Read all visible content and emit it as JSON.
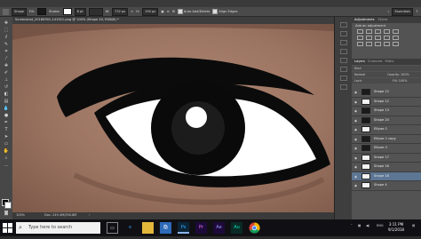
{
  "options_bar": {
    "mode": "Shape",
    "fill_label": "Fill:",
    "stroke_label": "Stroke:",
    "stroke_width": "8 pt",
    "w_label": "W:",
    "w_value": "732 px",
    "h_label": "H:",
    "h_value": "190 px",
    "auto_add_delete": "Auto Add/Delete",
    "align_edges": "Align Edges",
    "workspace": "Essentials",
    "accent_fill": "#1a1a1a"
  },
  "document": {
    "tab_title": "Screenshot_20180901-141921.png @ 100% (Shape 20, RGB/8) *",
    "zoom": "100%",
    "doc_size": "Doc: 249.4M/390.8M"
  },
  "panels": {
    "tab_adjustments": "Adjustments",
    "tab_styles": "Styles",
    "adjustments_title": "Add an adjustment",
    "tab_layers": "Layers",
    "tab_channels": "Channels",
    "tab_paths": "Paths",
    "kind_label": "Kind",
    "blend_mode": "Normal",
    "opacity_label": "Opacity: 100%",
    "lock_label": "Lock:",
    "fill_label": "Fill: 100%",
    "layers": [
      {
        "name": "Shape 12",
        "thumb": "dark"
      },
      {
        "name": "Shape 12",
        "thumb": "light"
      },
      {
        "name": "Shape 13",
        "thumb": "dark"
      },
      {
        "name": "Shape 20",
        "thumb": "dark"
      },
      {
        "name": "Ellipse 1",
        "thumb": "light"
      },
      {
        "name": "Ellipse 1 copy",
        "thumb": "dark"
      },
      {
        "name": "Ellipse 2",
        "thumb": "dark"
      },
      {
        "name": "Shape 17",
        "thumb": "light"
      },
      {
        "name": "Shape 16",
        "thumb": "light"
      },
      {
        "name": "Shape 18",
        "thumb": "selected"
      },
      {
        "name": "Shape 4",
        "thumb": "light"
      }
    ]
  },
  "taskbar": {
    "search_placeholder": "Type here to search",
    "apps": [
      "task-view",
      "edge",
      "file-explorer",
      "store",
      "photoshop",
      "premiere",
      "after-effects",
      "audition",
      "chrome"
    ],
    "time": "3:11 PM",
    "date": "9/1/2018"
  }
}
